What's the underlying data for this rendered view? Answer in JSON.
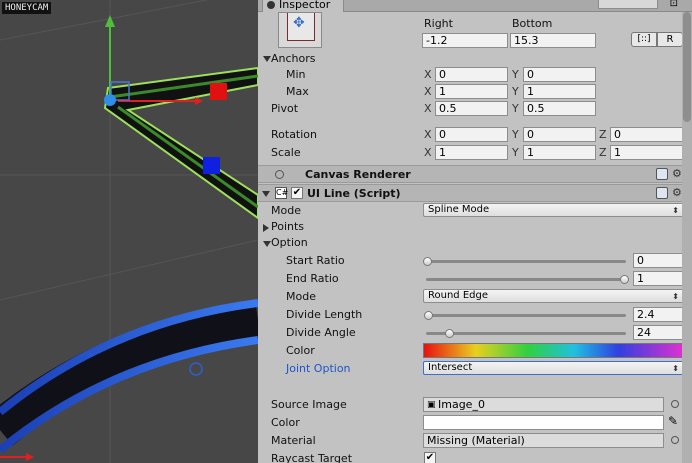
{
  "scene": {
    "watermark": "HONEYCAM"
  },
  "tab": {
    "label": "Inspector"
  },
  "rect": {
    "right_label": "Right",
    "bottom_label": "Bottom",
    "right_value": "-1.2",
    "bottom_value": "15.3",
    "blueprint_btn": "[::]",
    "raw_btn": "R"
  },
  "anchors": {
    "label": "Anchors",
    "min_label": "Min",
    "max_label": "Max",
    "min_x": "0",
    "min_y": "0",
    "max_x": "1",
    "max_y": "1"
  },
  "pivot": {
    "label": "Pivot",
    "x": "0.5",
    "y": "0.5"
  },
  "rotation": {
    "label": "Rotation",
    "x": "0",
    "y": "0",
    "z": "0"
  },
  "scale": {
    "label": "Scale",
    "x": "1",
    "y": "1",
    "z": "1"
  },
  "axes": {
    "x": "X",
    "y": "Y",
    "z": "Z"
  },
  "canvas_renderer": {
    "title": "Canvas Renderer"
  },
  "ui_line": {
    "title": "UI Line (Script)",
    "enabled": true,
    "mode_label": "Mode",
    "mode_value": "Spline Mode",
    "points_label": "Points",
    "option_label": "Option",
    "start_ratio_label": "Start Ratio",
    "start_ratio_value": "0",
    "start_ratio_fraction": 0.0,
    "end_ratio_label": "End Ratio",
    "end_ratio_value": "1",
    "end_ratio_fraction": 1.0,
    "opt_mode_label": "Mode",
    "opt_mode_value": "Round Edge",
    "divide_length_label": "Divide Length",
    "divide_length_value": "2.4",
    "divide_length_fraction": 0.0,
    "divide_angle_label": "Divide Angle",
    "divide_angle_value": "24",
    "divide_angle_fraction": 0.12,
    "color_label": "Color",
    "joint_option_label": "Joint Option",
    "joint_option_value": "Intersect",
    "source_image_label": "Source Image",
    "source_image_value": "Image_0",
    "color2_label": "Color",
    "material_label": "Material",
    "material_value": "Missing (Material)",
    "raycast_label": "Raycast Target",
    "raycast_checked": true
  },
  "colors": {
    "accent_blue": "#2f5ec9",
    "selected_line": "#9de05a"
  }
}
